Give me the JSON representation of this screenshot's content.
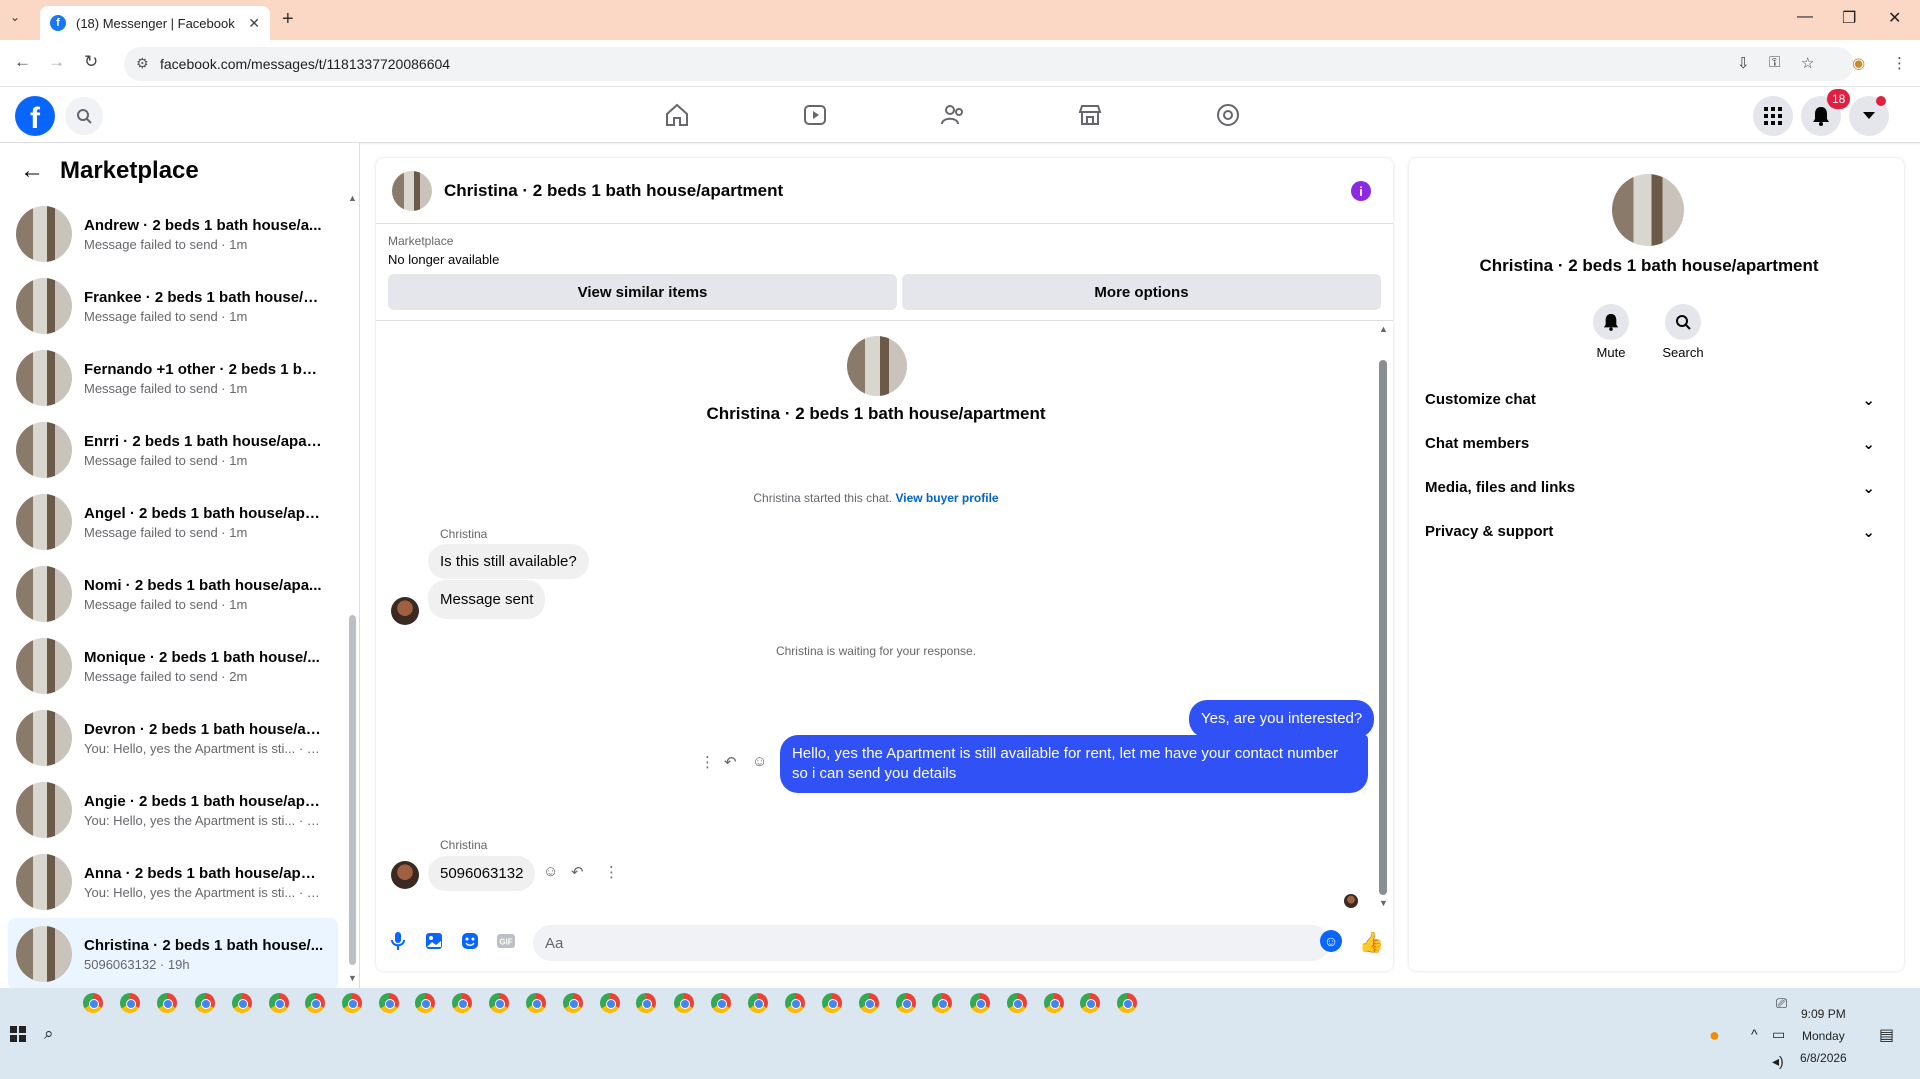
{
  "browser": {
    "tab_title": "(18) Messenger | Facebook",
    "url": "facebook.com/messages/t/1181337720086604"
  },
  "fb_header": {
    "notification_count": "18"
  },
  "sidebar": {
    "title": "Marketplace",
    "conversations": [
      {
        "name": "Andrew · 2 beds 1 bath house/a...",
        "preview": "Message failed to send · 1m"
      },
      {
        "name": "Frankee · 2 beds 1 bath house/a...",
        "preview": "Message failed to send · 1m"
      },
      {
        "name": "Fernando +1 other · 2 beds 1 bat...",
        "preview": "Message failed to send · 1m"
      },
      {
        "name": "Enrri · 2 beds 1 bath house/apart...",
        "preview": "Message failed to send · 1m"
      },
      {
        "name": "Angel · 2 beds 1 bath house/apa...",
        "preview": "Message failed to send · 1m"
      },
      {
        "name": "Nomi · 2 beds 1 bath house/apa...",
        "preview": "Message failed to send · 1m"
      },
      {
        "name": "Monique · 2 beds 1 bath house/...",
        "preview": "Message failed to send · 2m"
      },
      {
        "name": "Devron · 2 beds 1 bath house/ap...",
        "preview": "You: Hello, yes the Apartment is sti... · 2m"
      },
      {
        "name": "Angie · 2 beds 1 bath house/apa...",
        "preview": "You: Hello, yes the Apartment is sti... · 2m"
      },
      {
        "name": "Anna · 2 beds 1 bath house/apar...",
        "preview": "You: Hello, yes the Apartment is sti... · 2m"
      },
      {
        "name": "Christina · 2 beds 1 bath house/...",
        "preview": "5096063132 · 19h",
        "active": true
      }
    ]
  },
  "chat": {
    "title": "Christina · 2 beds 1 bath house/apartment",
    "listing_label": "Marketplace",
    "listing_status": "No longer available",
    "view_similar_label": "View similar items",
    "more_options_label": "More options",
    "started_text": "Christina started this chat.",
    "buyer_profile_link": "View buyer profile",
    "sender_name_1": "Christina",
    "msg_in_1": "Is this still available?",
    "msg_in_2": "Message sent",
    "waiting_text": "Christina is waiting for your response.",
    "msg_out_1": "Yes, are you interested?",
    "msg_out_2": "Hello, yes the Apartment is still available for rent, let me have your contact number so i can send you details",
    "sender_name_2": "Christina",
    "msg_in_3": "5096063132",
    "input_placeholder": "Aa"
  },
  "details": {
    "name": "Christina · 2 beds 1 bath house/apartment",
    "mute_label": "Mute",
    "search_label": "Search",
    "sections": [
      "Customize chat",
      "Chat members",
      "Media, files and links",
      "Privacy & support"
    ]
  },
  "taskbar": {
    "time": "9:09 PM",
    "day": "Monday",
    "date": "6/8/2026"
  },
  "colors": {
    "accent": "#0866ff",
    "outgoing_bubble": "#3051f5",
    "tab_bar": "#fbd8c6"
  }
}
